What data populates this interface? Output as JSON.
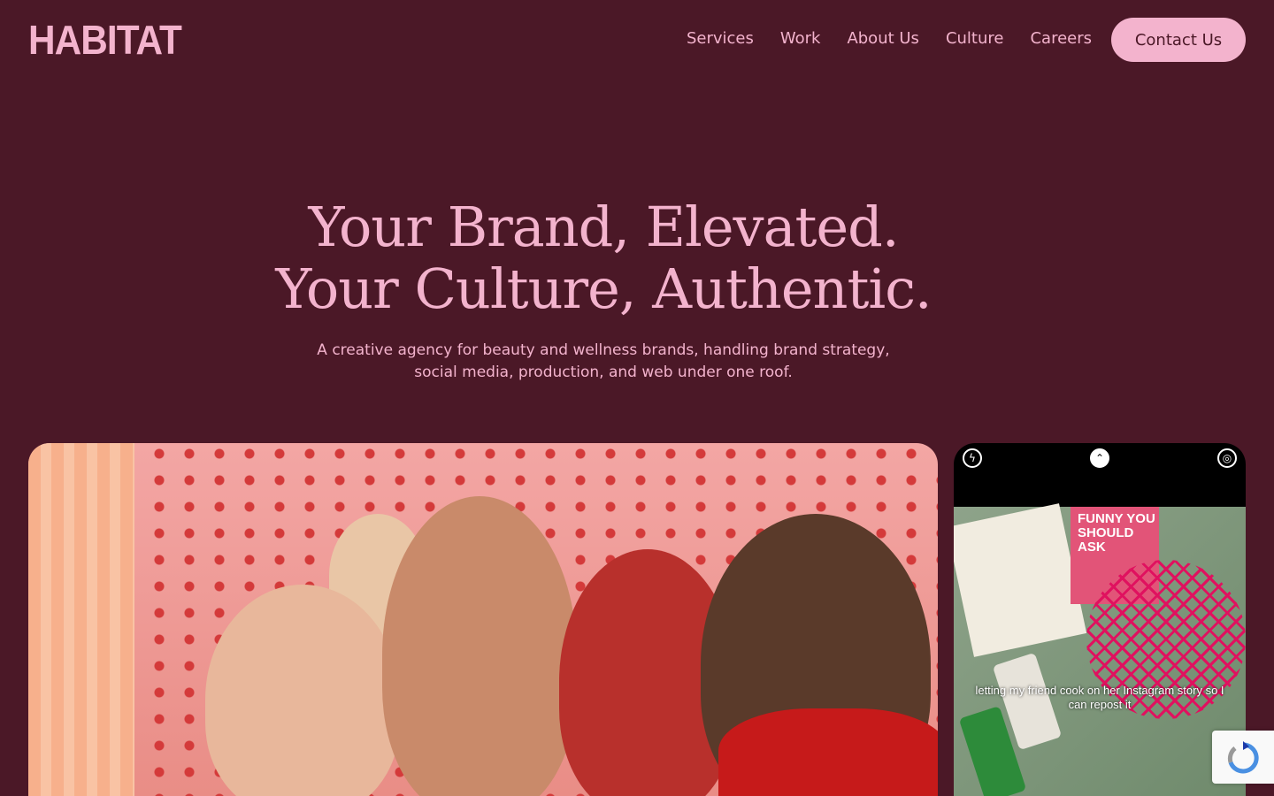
{
  "header": {
    "logo": "HABITAT",
    "nav": [
      "Services",
      "Work",
      "About Us",
      "Culture",
      "Careers"
    ],
    "contact": "Contact Us"
  },
  "hero": {
    "title_line1": "Your Brand, Elevated.",
    "title_line2": "Your Culture, Authentic.",
    "subtitle": "A creative agency for beauty and wellness brands, handling brand strategy, social media, production, and web under one roof."
  },
  "phone": {
    "magazine": "FUNNY YOU SHOULD ASK",
    "caption": "letting my friend cook on her Instagram story so I can repost it"
  },
  "icons": [
    "flash-off-icon",
    "chevron-up-icon",
    "live-off-icon",
    "recaptcha-icon"
  ],
  "colors": {
    "background": "#4b1827",
    "accent": "#f3b3cd"
  }
}
